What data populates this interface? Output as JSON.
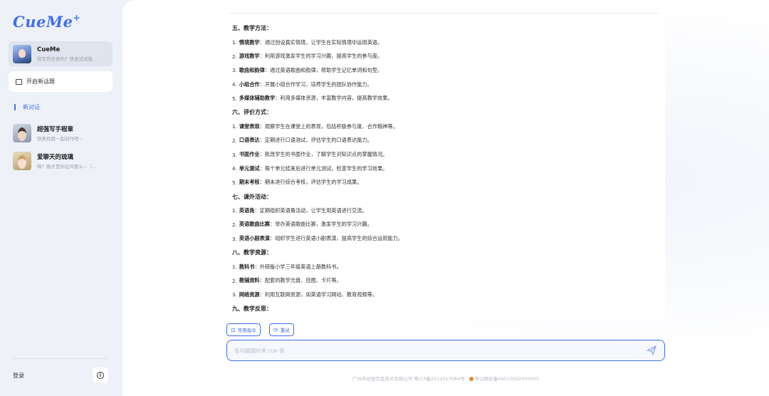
{
  "sidebar": {
    "logo": "CueMe",
    "active_chat": {
      "title": "CueMe",
      "subtitle": "有写作任务吗？快来试试我..."
    },
    "new_topic_label": "开启新话题",
    "section_label": "新对话",
    "chats": [
      {
        "title": "超强写手程章",
        "subtitle": "快来找我一起创作吧~"
      },
      {
        "title": "爱聊天的琉璃",
        "subtitle": "嗨？刚才是你在叫我么~（..."
      }
    ],
    "login_label": "登录"
  },
  "content": {
    "lines": [
      {
        "type": "heading",
        "text": "五、教学方法："
      },
      {
        "type": "item",
        "num": "1.",
        "term": "情境教学",
        "text": "：通过创设真实情境，让学生在实际情境中运用英语。"
      },
      {
        "type": "item",
        "num": "2.",
        "term": "游戏教学",
        "text": "：利用游戏激发学生的学习兴趣，提高学生的参与度。"
      },
      {
        "type": "item",
        "num": "3.",
        "term": "歌曲和韵律",
        "text": "：通过英语歌曲和韵律，帮助学生记忆单词和句型。"
      },
      {
        "type": "item",
        "num": "4.",
        "term": "小组合作",
        "text": "：开展小组合作学习，培养学生的团队协作能力。"
      },
      {
        "type": "item",
        "num": "5.",
        "term": "多媒体辅助教学",
        "text": "：利用多媒体资源，丰富教学内容，提高教学效果。"
      },
      {
        "type": "heading",
        "text": "六、评价方式："
      },
      {
        "type": "item",
        "num": "1.",
        "term": "课堂表现",
        "text": "：观察学生在课堂上的表现，包括积极参与度、合作精神等。"
      },
      {
        "type": "item",
        "num": "2.",
        "term": "口语表达",
        "text": "：定期进行口语测试，评估学生的口语表达能力。"
      },
      {
        "type": "item",
        "num": "3.",
        "term": "书面作业",
        "text": "：批改学生的书面作业，了解学生对知识点的掌握情况。"
      },
      {
        "type": "item",
        "num": "4.",
        "term": "单元测试",
        "text": "：每个单元结束后进行单元测试，检查学生的学习效果。"
      },
      {
        "type": "item",
        "num": "5.",
        "term": "期末考核",
        "text": "：期末进行综合考核，评估学生的学习成果。"
      },
      {
        "type": "heading",
        "text": "七、课外活动："
      },
      {
        "type": "item",
        "num": "1.",
        "term": "英语角",
        "text": "：定期组织英语角活动，让学生用英语进行交流。"
      },
      {
        "type": "item",
        "num": "2.",
        "term": "英语歌曲比赛",
        "text": "：举办英语歌曲比赛，激发学生的学习兴趣。"
      },
      {
        "type": "item",
        "num": "3.",
        "term": "英语小剧表演",
        "text": "：组织学生进行英语小剧表演，提高学生的综合运用能力。"
      },
      {
        "type": "heading",
        "text": "八、教学资源："
      },
      {
        "type": "item",
        "num": "1.",
        "term": "教科书",
        "text": "：外研版小学三年级英语上册教科书。"
      },
      {
        "type": "item",
        "num": "2.",
        "term": "教辅资料",
        "text": "：配套的教学光盘、挂图、卡片等。"
      },
      {
        "type": "item",
        "num": "3.",
        "term": "网络资源",
        "text": "：利用互联网资源，如英语学习网站、教育视频等。"
      },
      {
        "type": "heading",
        "text": "九、教学反思："
      }
    ]
  },
  "actions": {
    "common_commands": "常用指令",
    "retry": "重试"
  },
  "input": {
    "placeholder": "有问题随时来 cue 我"
  },
  "footer": {
    "company": "广州市动悦信息技术有限公司 粤ICP备2022013084号",
    "police": "粤公网安备44010502003055"
  },
  "colors": {
    "accent": "#3f6ff0"
  }
}
